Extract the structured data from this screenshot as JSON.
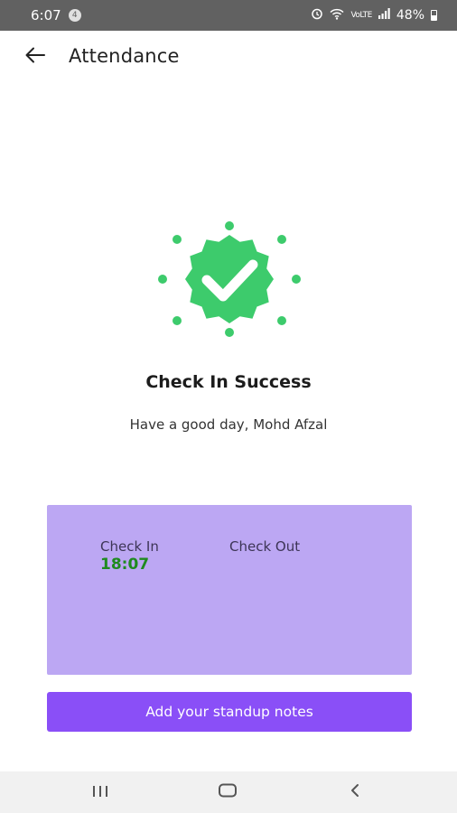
{
  "status_bar": {
    "time": "6:07",
    "notification_count": "4",
    "network_label": "VoLTE",
    "battery": "48%"
  },
  "app_bar": {
    "title": "Attendance",
    "back_icon": "arrow-left-icon"
  },
  "success": {
    "icon": "verified-check-badge-icon",
    "badge_color": "#3dcb6c",
    "title": "Check In Success",
    "subtitle": "Have a good day, Mohd Afzal"
  },
  "time_card": {
    "background": "#bca7f3",
    "check_in_label": "Check In",
    "check_in_value": "18:07",
    "check_out_label": "Check Out",
    "check_out_value": ""
  },
  "notes_button": {
    "label": "Add your standup notes",
    "color": "#8a4ff7"
  },
  "nav_bar": {
    "recents_icon": "recents-icon",
    "home_icon": "home-icon",
    "back_icon": "back-chevron-icon"
  }
}
